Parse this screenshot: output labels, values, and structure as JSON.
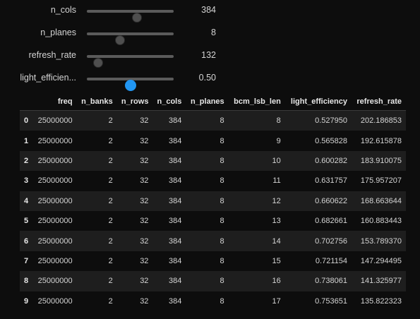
{
  "sliders": [
    {
      "label": "n_cols",
      "value": "384",
      "fraction": 0.58,
      "active": false
    },
    {
      "label": "n_planes",
      "value": "8",
      "fraction": 0.38,
      "active": false
    },
    {
      "label": "refresh_rate",
      "value": "132",
      "fraction": 0.13,
      "active": false
    },
    {
      "label": "light_efficien...",
      "value": "0.50",
      "fraction": 0.5,
      "active": true
    }
  ],
  "table": {
    "columns": [
      "",
      "freq",
      "n_banks",
      "n_rows",
      "n_cols",
      "n_planes",
      "bcm_lsb_len",
      "light_efficiency",
      "refresh_rate"
    ],
    "rows": [
      [
        "0",
        "25000000",
        "2",
        "32",
        "384",
        "8",
        "8",
        "0.527950",
        "202.186853"
      ],
      [
        "1",
        "25000000",
        "2",
        "32",
        "384",
        "8",
        "9",
        "0.565828",
        "192.615878"
      ],
      [
        "2",
        "25000000",
        "2",
        "32",
        "384",
        "8",
        "10",
        "0.600282",
        "183.910075"
      ],
      [
        "3",
        "25000000",
        "2",
        "32",
        "384",
        "8",
        "11",
        "0.631757",
        "175.957207"
      ],
      [
        "4",
        "25000000",
        "2",
        "32",
        "384",
        "8",
        "12",
        "0.660622",
        "168.663644"
      ],
      [
        "5",
        "25000000",
        "2",
        "32",
        "384",
        "8",
        "13",
        "0.682661",
        "160.883443"
      ],
      [
        "6",
        "25000000",
        "2",
        "32",
        "384",
        "8",
        "14",
        "0.702756",
        "153.789370"
      ],
      [
        "7",
        "25000000",
        "2",
        "32",
        "384",
        "8",
        "15",
        "0.721154",
        "147.294495"
      ],
      [
        "8",
        "25000000",
        "2",
        "32",
        "384",
        "8",
        "16",
        "0.738061",
        "141.325977"
      ],
      [
        "9",
        "25000000",
        "2",
        "32",
        "384",
        "8",
        "17",
        "0.753651",
        "135.822323"
      ]
    ]
  }
}
